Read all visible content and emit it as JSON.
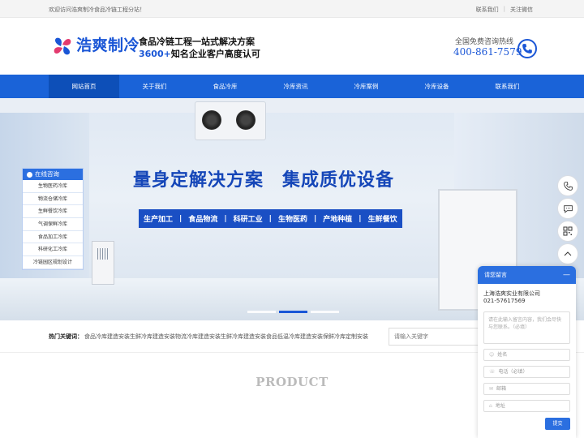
{
  "topbar": {
    "welcome": "欢迎访问浩爽制冷食品冷链工程分站！",
    "links": [
      "联系我们",
      "关注微信"
    ]
  },
  "header": {
    "brand": "浩爽制冷",
    "slogan_line1": "食品冷链工程一站式解决方案",
    "slogan_line2_highlight": "3600+",
    "slogan_line2_rest": "知名企业客户高度认可",
    "hotline_label": "全国免费咨询热线",
    "hotline_number": "400-861-7579",
    "logo_icon": "pinwheel-logo-icon",
    "phone_icon": "phone-icon"
  },
  "nav": {
    "items": [
      "网站首页",
      "关于我们",
      "食品冷库",
      "冷库资讯",
      "冷库案例",
      "冷库设备",
      "联系我们"
    ],
    "active_index": 0
  },
  "banner": {
    "headline": "量身定解决方案　集成质优设备",
    "tags": [
      "生产加工",
      "食品物流",
      "科研工业",
      "生物医药",
      "产地种植",
      "生鲜餐饮"
    ],
    "slide_count": 3,
    "active_slide": 1,
    "badge": "5"
  },
  "consult": {
    "title": "在线咨询",
    "items": [
      "生物医药冷库",
      "物流仓储冷库",
      "生鲜餐饮冷库",
      "气调保鲜冷库",
      "食品加工冷库",
      "科研化工冷库",
      "冷链园区规划设计"
    ]
  },
  "hot": {
    "label": "热门关键词：",
    "words": "食品冷库建造安装生鲜冷库建造安装物流冷库建造安装生鲜冷库建造安装食品低温冷库建造安装保鲜冷库定制安装",
    "search_placeholder": "请输入关键字"
  },
  "section": {
    "title": "PRODUCT"
  },
  "float_tools": [
    "phone-icon",
    "chat-icon",
    "qrcode-icon",
    "back-to-top-icon"
  ],
  "message_panel": {
    "title": "请您留言",
    "minimize": "—",
    "company": "上海浩爽实业有限公司",
    "phone": "021-57617569",
    "content_placeholder": "请在此输入留言内容，我们会尽快与您联系。（必填）",
    "fields": [
      {
        "icon": "user-icon",
        "placeholder": "姓名"
      },
      {
        "icon": "phone-icon",
        "placeholder": "电话（必填）"
      },
      {
        "icon": "mail-icon",
        "placeholder": "邮箱"
      },
      {
        "icon": "location-icon",
        "placeholder": "地址"
      }
    ],
    "submit": "提交"
  },
  "colors": {
    "brand_blue": "#1a56d6",
    "nav_blue": "#1a63d8",
    "nav_active": "#0d4fb8",
    "banner_tag_bg": "#1a4fc4"
  }
}
